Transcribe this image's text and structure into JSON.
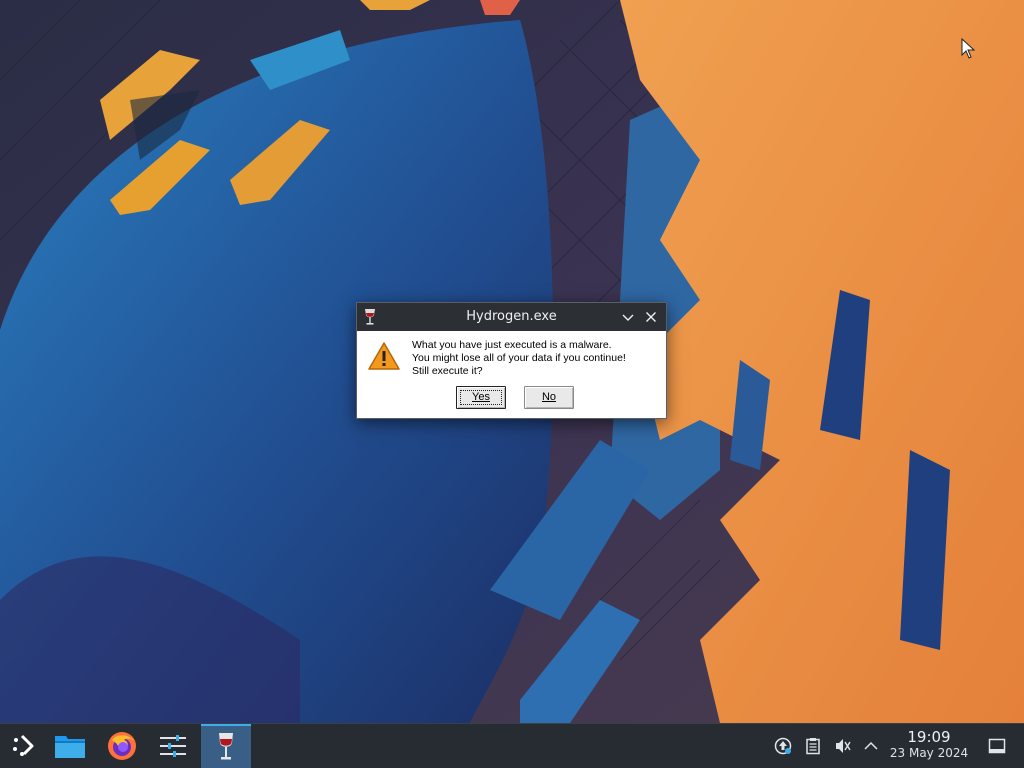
{
  "dialog": {
    "title": "Hydrogen.exe",
    "message": [
      "What you have just executed is a malware.",
      "You might lose all of your data if you continue!",
      "Still execute it?"
    ],
    "yes_label": "Yes",
    "no_label": "No"
  },
  "taskbar": {
    "launcher_icon": "kde-application-launcher-icon",
    "pinned": [
      {
        "name": "file-manager",
        "icon": "folder-icon"
      },
      {
        "name": "firefox",
        "icon": "firefox-icon"
      },
      {
        "name": "system-settings",
        "icon": "settings-sliders-icon"
      },
      {
        "name": "wine-app",
        "icon": "wine-glass-icon",
        "active": true
      }
    ],
    "tray": [
      "updates-icon",
      "clipboard-icon",
      "volume-muted-icon",
      "chevron-up-icon"
    ],
    "clock": {
      "time": "19:09",
      "date": "23 May 2024"
    }
  },
  "colors": {
    "accent": "#3daee9",
    "taskbar_bg": "#272c33",
    "dialog_titlebar": "#2c3035",
    "warning": "#f0a020"
  }
}
